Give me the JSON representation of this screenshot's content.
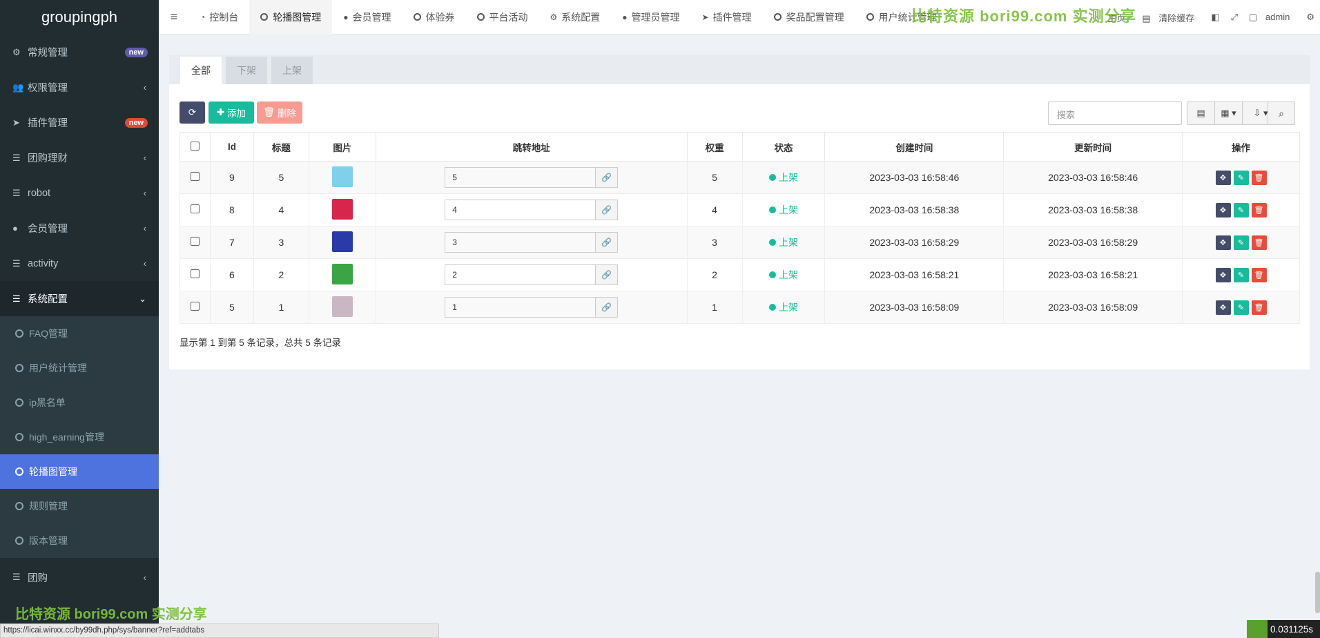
{
  "app": {
    "title": "groupingph"
  },
  "sidebar": {
    "items": [
      {
        "label": "常规管理",
        "icon": "gears-icon",
        "badge": "new"
      },
      {
        "label": "权限管理",
        "icon": "users-icon"
      },
      {
        "label": "插件管理",
        "icon": "rocket-icon",
        "badge": "new"
      },
      {
        "label": "团购理财",
        "icon": "list-icon"
      },
      {
        "label": "robot",
        "icon": "list-icon"
      },
      {
        "label": "会员管理",
        "icon": "user-circle-icon"
      },
      {
        "label": "activity",
        "icon": "list-icon"
      },
      {
        "label": "系统配置",
        "icon": "list-icon"
      }
    ],
    "submenu": [
      {
        "label": "FAQ管理"
      },
      {
        "label": "用户统计管理"
      },
      {
        "label": "ip黑名单"
      },
      {
        "label": "high_earning管理"
      },
      {
        "label": "轮播图管理"
      },
      {
        "label": "规则管理"
      },
      {
        "label": "版本管理"
      }
    ],
    "after": [
      {
        "label": "团购",
        "icon": "list-icon"
      }
    ]
  },
  "topbar": {
    "tabs": [
      {
        "label": "控制台",
        "icon": "dashboard-icon"
      },
      {
        "label": "轮播图管理",
        "icon": "circle-icon"
      },
      {
        "label": "会员管理",
        "icon": "user-icon"
      },
      {
        "label": "体验券",
        "icon": "circle-icon"
      },
      {
        "label": "平台活动",
        "icon": "circle-icon"
      },
      {
        "label": "系统配置",
        "icon": "gear-icon"
      },
      {
        "label": "管理员管理",
        "icon": "user-icon"
      },
      {
        "label": "插件管理",
        "icon": "rocket-icon"
      },
      {
        "label": "奖品配置管理",
        "icon": "circle-icon"
      },
      {
        "label": "用户统计管理",
        "icon": "circle-icon"
      }
    ],
    "right": {
      "home": "主页",
      "clear": "清除缓存",
      "user": "admin"
    }
  },
  "watermark": {
    "text": "比特资源 bori99.com 实测分享"
  },
  "content": {
    "subtabs": [
      "全部",
      "下架",
      "上架"
    ],
    "toolbar": {
      "add": "添加",
      "delete": "删除",
      "search_placeholder": "搜索"
    },
    "table": {
      "headers": [
        "Id",
        "标题",
        "图片",
        "跳转地址",
        "权重",
        "状态",
        "创建时间",
        "更新时间",
        "操作"
      ],
      "rows": [
        {
          "id": "9",
          "title": "5",
          "url": "5",
          "weight": "5",
          "status": "上架",
          "created": "2023-03-03 16:58:46",
          "updated": "2023-03-03 16:58:46",
          "thumb": "#7fd0ea"
        },
        {
          "id": "8",
          "title": "4",
          "url": "4",
          "weight": "4",
          "status": "上架",
          "created": "2023-03-03 16:58:38",
          "updated": "2023-03-03 16:58:38",
          "thumb": "#d8264b"
        },
        {
          "id": "7",
          "title": "3",
          "url": "3",
          "weight": "3",
          "status": "上架",
          "created": "2023-03-03 16:58:29",
          "updated": "2023-03-03 16:58:29",
          "thumb": "#2a3aa8"
        },
        {
          "id": "6",
          "title": "2",
          "url": "2",
          "weight": "2",
          "status": "上架",
          "created": "2023-03-03 16:58:21",
          "updated": "2023-03-03 16:58:21",
          "thumb": "#3aa544"
        },
        {
          "id": "5",
          "title": "1",
          "url": "1",
          "weight": "1",
          "status": "上架",
          "created": "2023-03-03 16:58:09",
          "updated": "2023-03-03 16:58:09",
          "thumb": "#c9b7c4"
        }
      ]
    },
    "pager": "显示第 1 到第 5 条记录，总共 5 条记录"
  },
  "statusbar": {
    "url": "https://licai.winxx.cc/by99dh.php/sys/banner?ref=addtabs"
  },
  "timer": {
    "value": "0.031125s"
  },
  "colors": {
    "sidebar": "#222d32",
    "active": "#4e73df",
    "success": "#18bc9c",
    "danger": "#e74c3c",
    "primary": "#444c69"
  }
}
